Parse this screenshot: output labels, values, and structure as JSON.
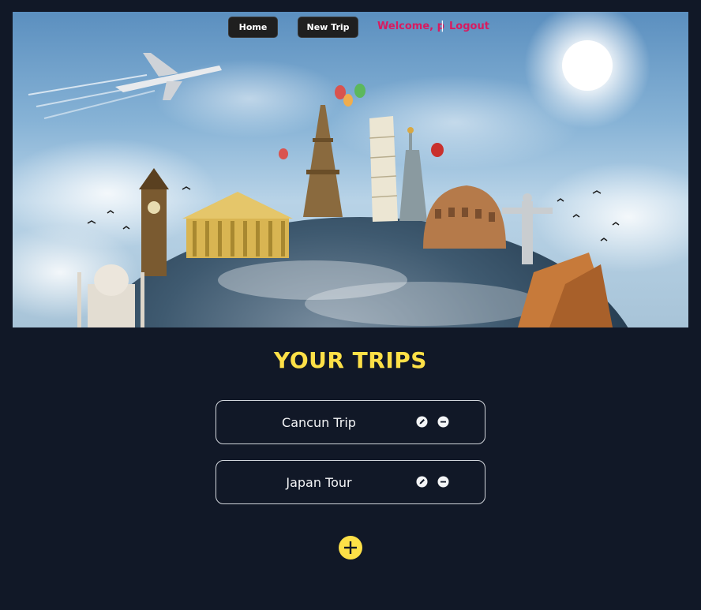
{
  "nav": {
    "home_label": "Home",
    "new_trip_label": "New Trip",
    "welcome_text": "Welcome, p",
    "separator": "|",
    "logout_label": "Logout"
  },
  "hero": {
    "image": "travel-landmarks-globe-banner"
  },
  "main": {
    "heading": "YOUR TRIPS",
    "trips": [
      {
        "name": "Cancun Trip"
      },
      {
        "name": "Japan Tour"
      }
    ],
    "add_icon": "plus-circle-icon"
  },
  "colors": {
    "background": "#111827",
    "heading": "#fde047",
    "accent": "#d81b60",
    "card_border": "#d1d5db"
  }
}
